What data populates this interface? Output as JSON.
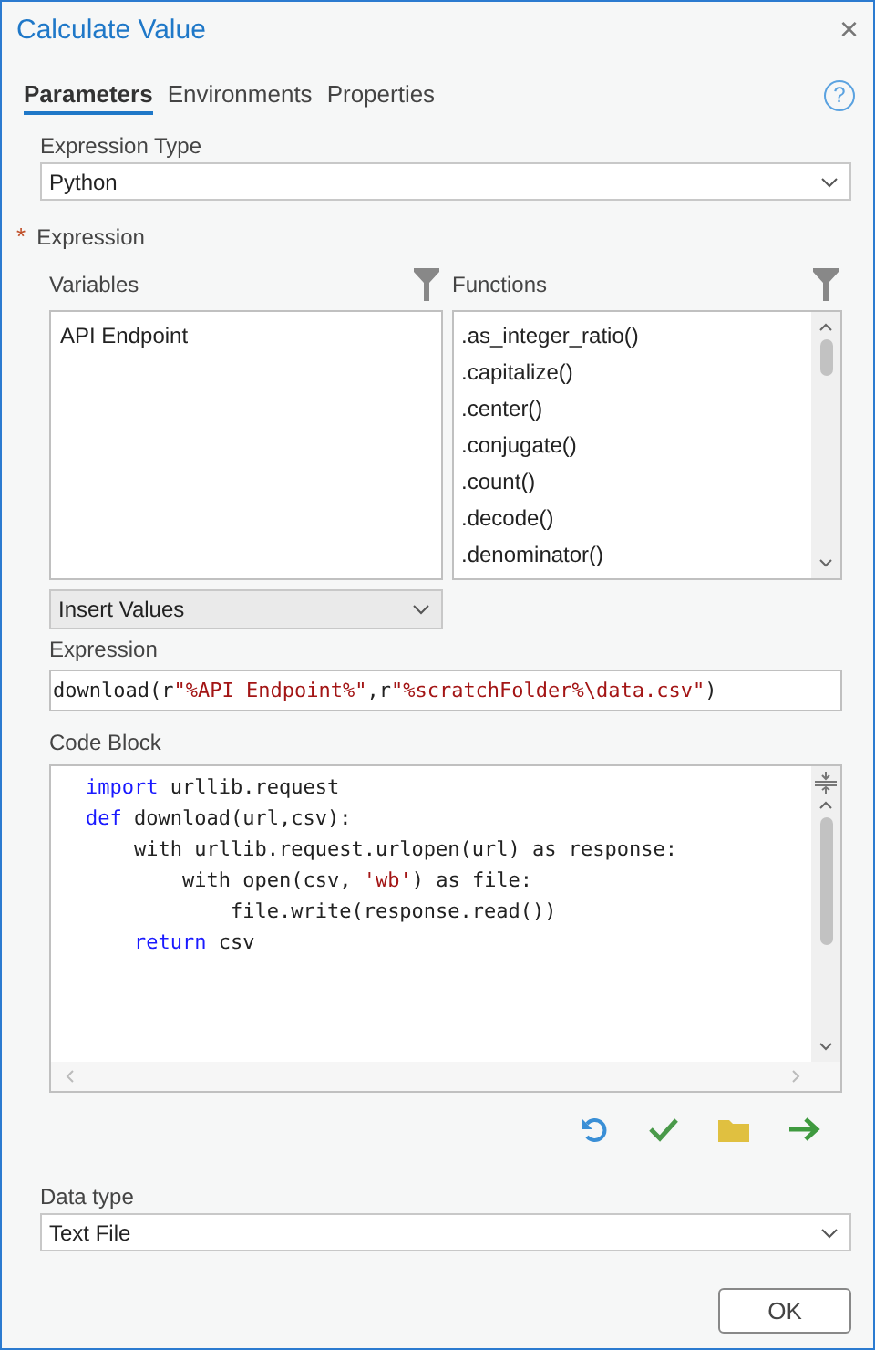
{
  "window": {
    "title": "Calculate Value",
    "close": "×"
  },
  "tabs": [
    {
      "label": "Parameters",
      "selected": true
    },
    {
      "label": "Environments",
      "selected": false
    },
    {
      "label": "Properties",
      "selected": false
    }
  ],
  "help": "?",
  "expression_type": {
    "label": "Expression Type",
    "value": "Python"
  },
  "expression_section": {
    "required_mark": "*",
    "label": "Expression"
  },
  "variables": {
    "label": "Variables",
    "items": [
      {
        "label": "API Endpoint",
        "selected": false
      }
    ]
  },
  "functions": {
    "label": "Functions",
    "items": [
      {
        "label": ".as_integer_ratio()",
        "selected": false
      },
      {
        "label": ".capitalize()",
        "selected": false
      },
      {
        "label": ".center()",
        "selected": false
      },
      {
        "label": ".conjugate()",
        "selected": false
      },
      {
        "label": ".count()",
        "selected": false
      },
      {
        "label": ".decode()",
        "selected": false
      },
      {
        "label": ".denominator()",
        "selected": false
      }
    ]
  },
  "insert_values": {
    "value": "Insert Values"
  },
  "expression": {
    "label": "Expression",
    "tokens": [
      {
        "kind": "plain",
        "text": "download(r"
      },
      {
        "kind": "string",
        "text": "\"%API Endpoint%\""
      },
      {
        "kind": "plain",
        "text": ",r"
      },
      {
        "kind": "string",
        "text": "\"%scratchFolder%\\data.csv\""
      },
      {
        "kind": "plain",
        "text": ")"
      }
    ]
  },
  "code_block": {
    "label": "Code Block",
    "lines": [
      [
        {
          "kind": "keyword",
          "text": "import"
        },
        {
          "kind": "plain",
          "text": " urllib.request"
        }
      ],
      [
        {
          "kind": "keyword",
          "text": "def"
        },
        {
          "kind": "plain",
          "text": " download(url,csv):"
        }
      ],
      [
        {
          "kind": "plain",
          "text": "    with urllib.request.urlopen(url) as response:"
        }
      ],
      [
        {
          "kind": "plain",
          "text": "        with open(csv, "
        },
        {
          "kind": "string",
          "text": "'wb'"
        },
        {
          "kind": "plain",
          "text": ") as file:"
        }
      ],
      [
        {
          "kind": "plain",
          "text": "            file.write(response.read())"
        }
      ],
      [
        {
          "kind": "keyword",
          "text": "    return"
        },
        {
          "kind": "plain",
          "text": " csv"
        }
      ]
    ]
  },
  "data_type": {
    "label": "Data type",
    "value": "Text File"
  },
  "buttons": [
    "OK"
  ]
}
